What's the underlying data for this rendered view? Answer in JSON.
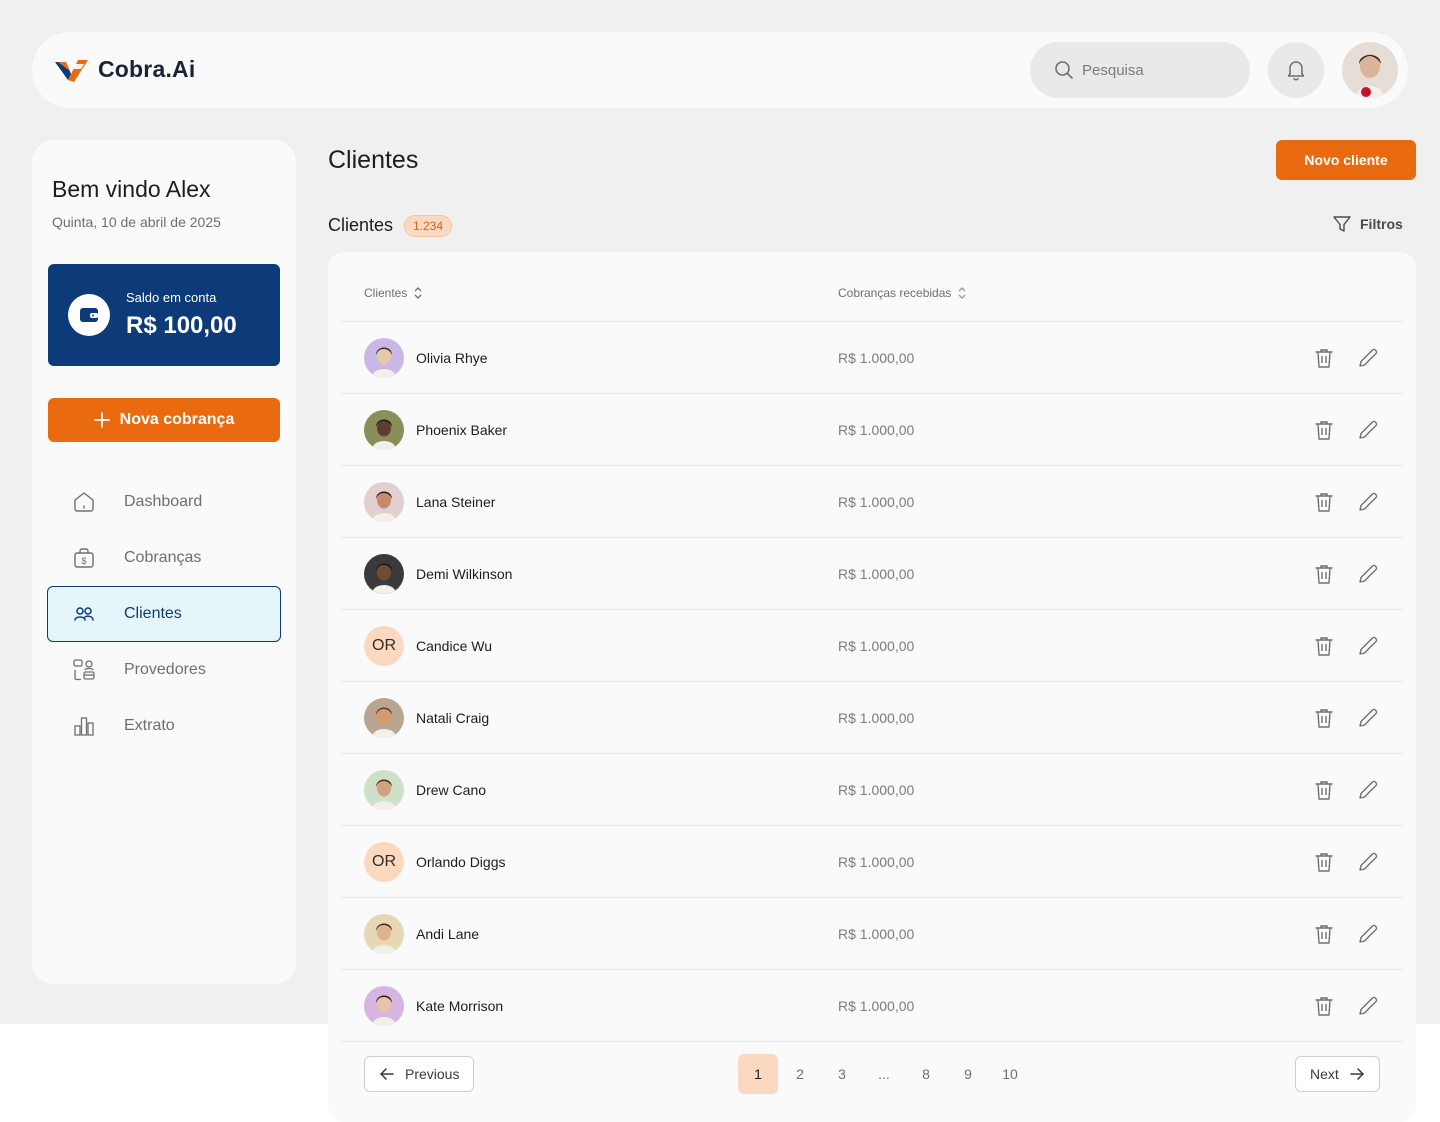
{
  "app": {
    "name": "Cobra.Ai"
  },
  "header": {
    "search_placeholder": "Pesquisa",
    "icons": {
      "search": "search-icon",
      "notifications": "bell-icon",
      "profile": "user-avatar"
    }
  },
  "sidebar": {
    "welcome": "Bem vindo Alex",
    "date": "Quinta, 10 de abril de 2025",
    "balance": {
      "label": "Saldo em conta",
      "value": "R$ 100,00"
    },
    "new_charge_label": "Nova cobrança",
    "items": [
      {
        "label": "Dashboard",
        "icon": "home-icon",
        "active": false
      },
      {
        "label": "Cobranças",
        "icon": "money-bag-icon",
        "active": false
      },
      {
        "label": "Clientes",
        "icon": "users-icon",
        "active": true
      },
      {
        "label": "Provedores",
        "icon": "providers-icon",
        "active": false
      },
      {
        "label": "Extrato",
        "icon": "bar-chart-icon",
        "active": false
      }
    ]
  },
  "main": {
    "title": "Clientes",
    "new_client_label": "Novo cliente",
    "section_title": "Clientes",
    "count": "1.234",
    "filter_label": "Filtros",
    "columns": {
      "client": "Clientes",
      "received": "Cobranças recebidas"
    },
    "rows": [
      {
        "name": "Olivia Rhye",
        "amount": "R$ 1.000,00",
        "avatar": "photo",
        "initials": ""
      },
      {
        "name": "Phoenix Baker",
        "amount": "R$ 1.000,00",
        "avatar": "photo",
        "initials": ""
      },
      {
        "name": "Lana Steiner",
        "amount": "R$ 1.000,00",
        "avatar": "photo",
        "initials": ""
      },
      {
        "name": "Demi Wilkinson",
        "amount": "R$ 1.000,00",
        "avatar": "photo",
        "initials": ""
      },
      {
        "name": "Candice Wu",
        "amount": "R$ 1.000,00",
        "avatar": "initials",
        "initials": "OR"
      },
      {
        "name": "Natali Craig",
        "amount": "R$ 1.000,00",
        "avatar": "photo",
        "initials": ""
      },
      {
        "name": "Drew Cano",
        "amount": "R$ 1.000,00",
        "avatar": "photo",
        "initials": ""
      },
      {
        "name": "Orlando Diggs",
        "amount": "R$ 1.000,00",
        "avatar": "initials",
        "initials": "OR"
      },
      {
        "name": "Andi Lane",
        "amount": "R$ 1.000,00",
        "avatar": "photo",
        "initials": ""
      },
      {
        "name": "Kate Morrison",
        "amount": "R$ 1.000,00",
        "avatar": "photo",
        "initials": ""
      }
    ],
    "pagination": {
      "previous_label": "Previous",
      "next_label": "Next",
      "pages": [
        "1",
        "2",
        "3",
        "...",
        "8",
        "9",
        "10"
      ],
      "current": "1"
    }
  },
  "colors": {
    "accent": "#ea6a10",
    "brand_blue": "#0d3a78",
    "badge_bg": "#fbd9c1",
    "active_nav_bg": "#e5f6fb"
  }
}
